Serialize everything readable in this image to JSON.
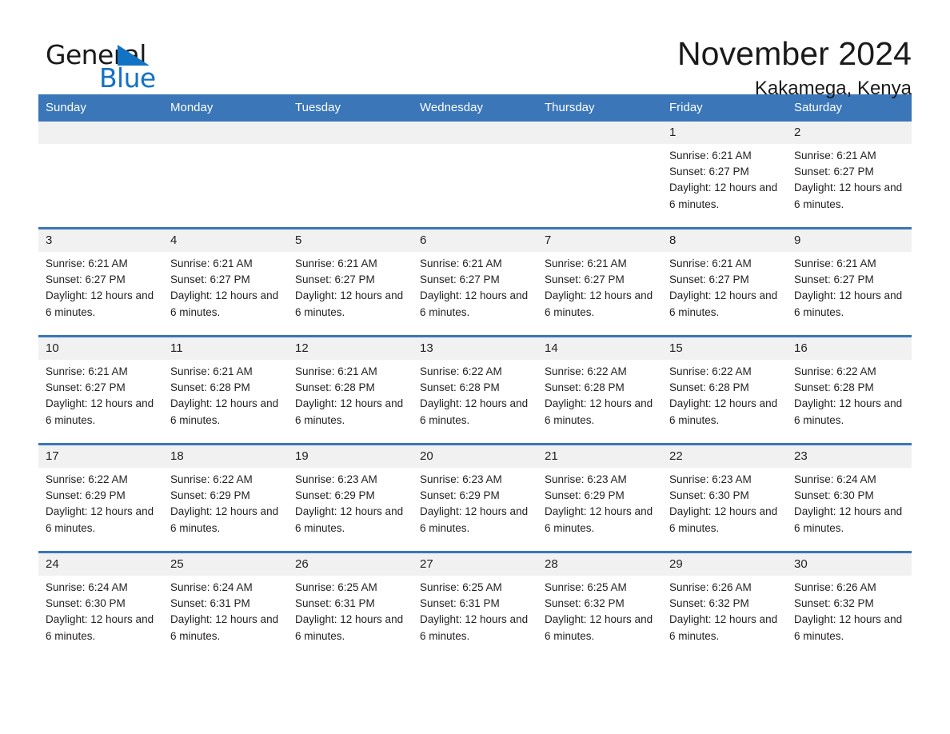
{
  "brand": {
    "name_part1": "General",
    "name_part2": "Blue",
    "triangle_icon": "triangle-icon",
    "accent_color": "#1273c4"
  },
  "header": {
    "month_title": "November 2024",
    "location": "Kakamega, Kenya"
  },
  "calendar": {
    "header_bg": "#3a76b8",
    "daynum_bg": "#f1f1f1",
    "day_names": [
      "Sunday",
      "Monday",
      "Tuesday",
      "Wednesday",
      "Thursday",
      "Friday",
      "Saturday"
    ],
    "weeks": [
      [
        {
          "day": "",
          "sunrise": "",
          "sunset": "",
          "daylight": ""
        },
        {
          "day": "",
          "sunrise": "",
          "sunset": "",
          "daylight": ""
        },
        {
          "day": "",
          "sunrise": "",
          "sunset": "",
          "daylight": ""
        },
        {
          "day": "",
          "sunrise": "",
          "sunset": "",
          "daylight": ""
        },
        {
          "day": "",
          "sunrise": "",
          "sunset": "",
          "daylight": ""
        },
        {
          "day": "1",
          "sunrise": "Sunrise: 6:21 AM",
          "sunset": "Sunset: 6:27 PM",
          "daylight": "Daylight: 12 hours and 6 minutes."
        },
        {
          "day": "2",
          "sunrise": "Sunrise: 6:21 AM",
          "sunset": "Sunset: 6:27 PM",
          "daylight": "Daylight: 12 hours and 6 minutes."
        }
      ],
      [
        {
          "day": "3",
          "sunrise": "Sunrise: 6:21 AM",
          "sunset": "Sunset: 6:27 PM",
          "daylight": "Daylight: 12 hours and 6 minutes."
        },
        {
          "day": "4",
          "sunrise": "Sunrise: 6:21 AM",
          "sunset": "Sunset: 6:27 PM",
          "daylight": "Daylight: 12 hours and 6 minutes."
        },
        {
          "day": "5",
          "sunrise": "Sunrise: 6:21 AM",
          "sunset": "Sunset: 6:27 PM",
          "daylight": "Daylight: 12 hours and 6 minutes."
        },
        {
          "day": "6",
          "sunrise": "Sunrise: 6:21 AM",
          "sunset": "Sunset: 6:27 PM",
          "daylight": "Daylight: 12 hours and 6 minutes."
        },
        {
          "day": "7",
          "sunrise": "Sunrise: 6:21 AM",
          "sunset": "Sunset: 6:27 PM",
          "daylight": "Daylight: 12 hours and 6 minutes."
        },
        {
          "day": "8",
          "sunrise": "Sunrise: 6:21 AM",
          "sunset": "Sunset: 6:27 PM",
          "daylight": "Daylight: 12 hours and 6 minutes."
        },
        {
          "day": "9",
          "sunrise": "Sunrise: 6:21 AM",
          "sunset": "Sunset: 6:27 PM",
          "daylight": "Daylight: 12 hours and 6 minutes."
        }
      ],
      [
        {
          "day": "10",
          "sunrise": "Sunrise: 6:21 AM",
          "sunset": "Sunset: 6:27 PM",
          "daylight": "Daylight: 12 hours and 6 minutes."
        },
        {
          "day": "11",
          "sunrise": "Sunrise: 6:21 AM",
          "sunset": "Sunset: 6:28 PM",
          "daylight": "Daylight: 12 hours and 6 minutes."
        },
        {
          "day": "12",
          "sunrise": "Sunrise: 6:21 AM",
          "sunset": "Sunset: 6:28 PM",
          "daylight": "Daylight: 12 hours and 6 minutes."
        },
        {
          "day": "13",
          "sunrise": "Sunrise: 6:22 AM",
          "sunset": "Sunset: 6:28 PM",
          "daylight": "Daylight: 12 hours and 6 minutes."
        },
        {
          "day": "14",
          "sunrise": "Sunrise: 6:22 AM",
          "sunset": "Sunset: 6:28 PM",
          "daylight": "Daylight: 12 hours and 6 minutes."
        },
        {
          "day": "15",
          "sunrise": "Sunrise: 6:22 AM",
          "sunset": "Sunset: 6:28 PM",
          "daylight": "Daylight: 12 hours and 6 minutes."
        },
        {
          "day": "16",
          "sunrise": "Sunrise: 6:22 AM",
          "sunset": "Sunset: 6:28 PM",
          "daylight": "Daylight: 12 hours and 6 minutes."
        }
      ],
      [
        {
          "day": "17",
          "sunrise": "Sunrise: 6:22 AM",
          "sunset": "Sunset: 6:29 PM",
          "daylight": "Daylight: 12 hours and 6 minutes."
        },
        {
          "day": "18",
          "sunrise": "Sunrise: 6:22 AM",
          "sunset": "Sunset: 6:29 PM",
          "daylight": "Daylight: 12 hours and 6 minutes."
        },
        {
          "day": "19",
          "sunrise": "Sunrise: 6:23 AM",
          "sunset": "Sunset: 6:29 PM",
          "daylight": "Daylight: 12 hours and 6 minutes."
        },
        {
          "day": "20",
          "sunrise": "Sunrise: 6:23 AM",
          "sunset": "Sunset: 6:29 PM",
          "daylight": "Daylight: 12 hours and 6 minutes."
        },
        {
          "day": "21",
          "sunrise": "Sunrise: 6:23 AM",
          "sunset": "Sunset: 6:29 PM",
          "daylight": "Daylight: 12 hours and 6 minutes."
        },
        {
          "day": "22",
          "sunrise": "Sunrise: 6:23 AM",
          "sunset": "Sunset: 6:30 PM",
          "daylight": "Daylight: 12 hours and 6 minutes."
        },
        {
          "day": "23",
          "sunrise": "Sunrise: 6:24 AM",
          "sunset": "Sunset: 6:30 PM",
          "daylight": "Daylight: 12 hours and 6 minutes."
        }
      ],
      [
        {
          "day": "24",
          "sunrise": "Sunrise: 6:24 AM",
          "sunset": "Sunset: 6:30 PM",
          "daylight": "Daylight: 12 hours and 6 minutes."
        },
        {
          "day": "25",
          "sunrise": "Sunrise: 6:24 AM",
          "sunset": "Sunset: 6:31 PM",
          "daylight": "Daylight: 12 hours and 6 minutes."
        },
        {
          "day": "26",
          "sunrise": "Sunrise: 6:25 AM",
          "sunset": "Sunset: 6:31 PM",
          "daylight": "Daylight: 12 hours and 6 minutes."
        },
        {
          "day": "27",
          "sunrise": "Sunrise: 6:25 AM",
          "sunset": "Sunset: 6:31 PM",
          "daylight": "Daylight: 12 hours and 6 minutes."
        },
        {
          "day": "28",
          "sunrise": "Sunrise: 6:25 AM",
          "sunset": "Sunset: 6:32 PM",
          "daylight": "Daylight: 12 hours and 6 minutes."
        },
        {
          "day": "29",
          "sunrise": "Sunrise: 6:26 AM",
          "sunset": "Sunset: 6:32 PM",
          "daylight": "Daylight: 12 hours and 6 minutes."
        },
        {
          "day": "30",
          "sunrise": "Sunrise: 6:26 AM",
          "sunset": "Sunset: 6:32 PM",
          "daylight": "Daylight: 12 hours and 6 minutes."
        }
      ]
    ]
  }
}
